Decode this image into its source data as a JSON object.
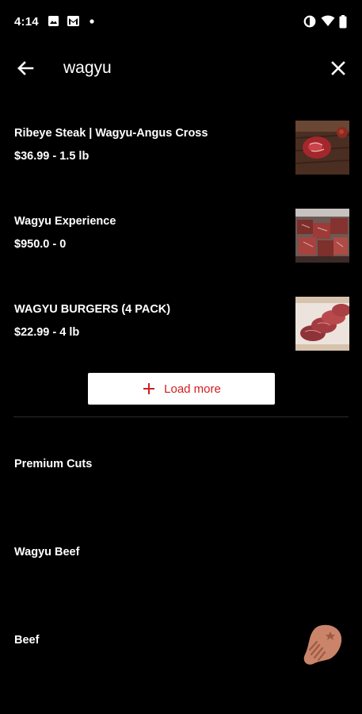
{
  "status": {
    "time": "4:14",
    "icons": [
      "image-icon",
      "gmail-icon",
      "notification-dot-icon",
      "data-saver-icon",
      "wifi-icon",
      "battery-icon"
    ]
  },
  "search": {
    "query": "wagyu",
    "back_icon": "arrow-left-icon",
    "clear_icon": "close-icon"
  },
  "results": [
    {
      "name": "Ribeye Steak | Wagyu-Angus Cross",
      "price": "$36.99 - 1.5 lb",
      "thumb": "ribeye-steak-image"
    },
    {
      "name": "Wagyu Experience",
      "price": "$950.0 - 0",
      "thumb": "wagyu-cubes-image"
    },
    {
      "name": "WAGYU BURGERS (4 PACK)",
      "price": "$22.99 - 4 lb",
      "thumb": "wagyu-burgers-image"
    }
  ],
  "load_more": {
    "label": "Load more",
    "icon": "plus-icon",
    "color": "#cf1f1f"
  },
  "categories": [
    "Premium Cuts",
    "Wagyu Beef",
    "Beef"
  ],
  "fab": {
    "icon": "steak-icon",
    "color": "#c9846a"
  }
}
